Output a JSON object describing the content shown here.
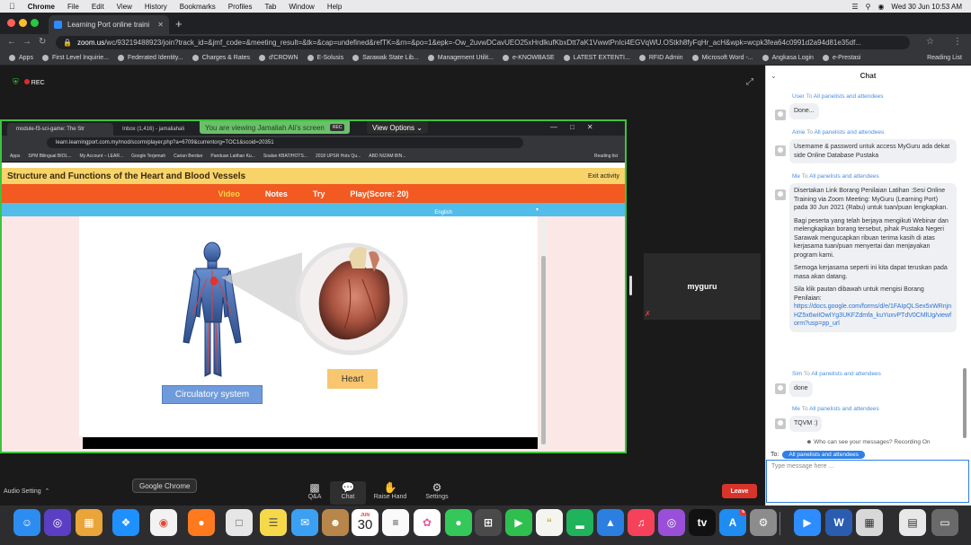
{
  "menubar": {
    "app": "Chrome",
    "items": [
      "File",
      "Edit",
      "View",
      "History",
      "Bookmarks",
      "Profiles",
      "Tab",
      "Window",
      "Help"
    ],
    "clock": "Wed 30 Jun  10:53 AM"
  },
  "browser": {
    "tab_title": "Learning Port online traini",
    "url_host": "zoom.us",
    "url_rest": "/wc/93219488923/join?track_id=&jmf_code=&meeting_result=&tk=&cap=undefined&refTK=&rn=&po=1&epk=-Ow_2uvwDCavUEO25xHrdlkufKbxDtt7aK1VwwtPnIci4EGVqWU.OStkh8fyFqHr_acH&wpk=wcpk3fea64c0991d2a94d81e35df...",
    "bookmarks": [
      "Apps",
      "First Level Inquirie...",
      "Federated Identity...",
      "Charges & Rates",
      "d'CROWN",
      "E-Solusis",
      "Sarawak State Lib...",
      "Management Utilit...",
      "e-KNOWBASE",
      "LATEST EXTENTI...",
      "RFID Admin",
      "Microsoft Word -...",
      "Angkasa Login",
      "e-Prestasi"
    ],
    "reading_list": "Reading List"
  },
  "zoom": {
    "rec_label": "REC",
    "viewing_banner": "You are viewing Jamaliah Ali's screen",
    "viewing_rec": "REC",
    "view_options": "View Options",
    "participant_name": "myguru",
    "audio_setting": "Audio Setting",
    "tooltip": "Google Chrome",
    "toolbar": [
      {
        "label": "Q&A",
        "icon": "qa-icon"
      },
      {
        "label": "Chat",
        "icon": "chat-icon"
      },
      {
        "label": "Raise Hand",
        "icon": "hand-icon"
      },
      {
        "label": "Settings",
        "icon": "gear-icon"
      }
    ],
    "leave": "Leave"
  },
  "shared": {
    "tab1": "module-f3-sci-game: The Str",
    "tab2": "Inbox (1,416) - jamaliahali",
    "url": "learn.learningport.com.my/mod/scorm/player.php?a=6709&currentorg=TOC1&scoid=20351",
    "bookmarks": [
      "Apps",
      "SPM Bilingual BIOL...",
      "My Account – LEAR...",
      "Google Terjemah",
      "Carian Berdan",
      "Panduan Latihan Ku...",
      "Soalan KBAT/HOTS...",
      "2018 UPSR Hots Qu...",
      "ABD NIZAM BIN...",
      "Reading list"
    ],
    "course_title": "Structure and Functions of the Heart and Blood Vessels",
    "exit": "Exit activity",
    "nav": [
      "Video",
      "Notes",
      "Try",
      "Play(Score: 20)"
    ],
    "language": "English",
    "label_system": "Circulatory system",
    "label_heart": "Heart"
  },
  "chat": {
    "title": "Chat",
    "messages": [
      {
        "sender": "User",
        "to": "All panelists and attendees",
        "text": [
          "Done..."
        ]
      },
      {
        "sender": "Ainie",
        "to": "All panelists and attendees",
        "text": [
          "Username & password untuk access MyGuru ada dekat side Online Database Pustaka"
        ]
      },
      {
        "sender": "Me",
        "to": "All panelists and attendees",
        "text": [
          "Disertakan Link Borang Penilaian Latihan :Sesi Online Training via Zoom Meeting: MyGuru (Learning Port) pada 30 Jun 2021 (Rabu) untuk tuan/puan lengkapkan.",
          "Bagi peserta yang telah berjaya mengikuti Webinar dan melengkapkan borang tersebut, pihak Pustaka Negeri Sarawak mengucapkan ribuan terima kasih di atas kerjasama tuan/puan menyertai dan menjayakan program kami.",
          "Semoga kerjasama seperti ini kita dapat teruskan pada masa akan datang.",
          "Sila klik pautan dibawah untuk mengisi Borang Penilaian:"
        ],
        "link": "https://docs.google.com/forms/d/e/1FAIpQLSex5xWRnjnHZ5x6wiIOwIYg3UKFZdmfa_kuYuxvPTdV0CMlUg/viewform?usp=pp_url"
      },
      {
        "sender": "Sim",
        "to": "All panelists and attendees",
        "text": [
          "done"
        ]
      },
      {
        "sender": "Me",
        "to": "All panelists and attendees",
        "text": [
          "TQVM :)"
        ]
      }
    ],
    "to_word": "To",
    "who_can_see": "Who can see your messages? Recording On",
    "to_label": "To:",
    "to_target": "All panelists and attendees",
    "input_placeholder": "Type message here ..."
  },
  "dock": {
    "calendar_month": "JUN",
    "calendar_day": "30",
    "appstore_badge": "6"
  }
}
